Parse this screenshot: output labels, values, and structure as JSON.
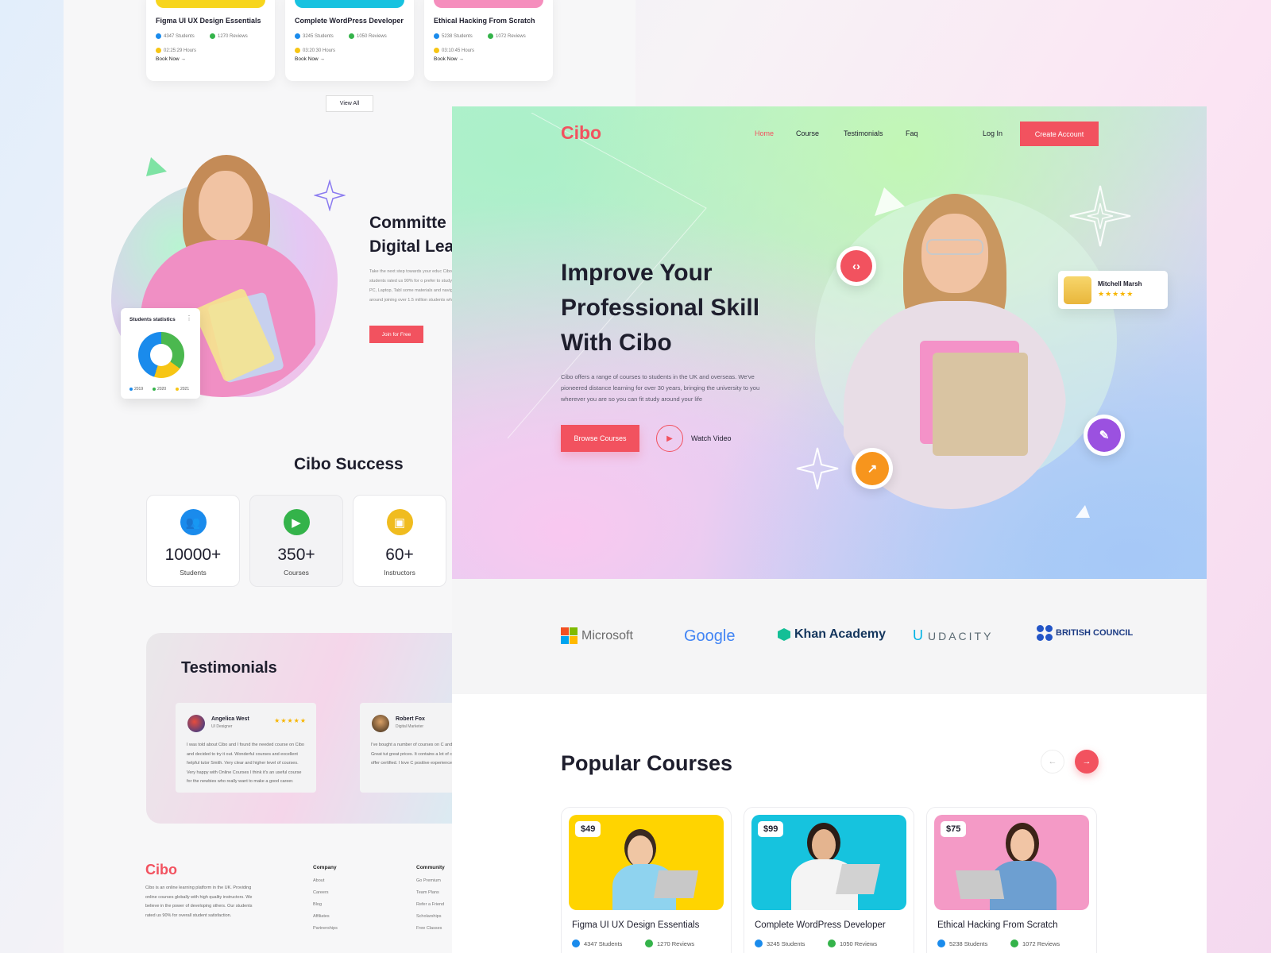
{
  "colors": {
    "accent": "#f2525f",
    "blue": "#1a8bec",
    "green": "#34b34a",
    "yellow": "#f7c514",
    "star": "#f7b500"
  },
  "back": {
    "mini_courses": [
      {
        "title": "Figma UI UX Design Essentials",
        "students": "4347 Students",
        "reviews": "1270 Reviews",
        "hours": "02:25:29 Hours",
        "cta": "Book Now →"
      },
      {
        "title": "Complete WordPress Developer",
        "students": "3245 Students",
        "reviews": "1050 Reviews",
        "hours": "03:20:30 Hours",
        "cta": "Book Now →"
      },
      {
        "title": "Ethical Hacking From Scratch",
        "students": "5238 Students",
        "reviews": "1072 Reviews",
        "hours": "03:10:45 Hours",
        "cta": "Book Now →"
      }
    ],
    "view_all": "View All",
    "stats_card": {
      "title": "Students statistics",
      "legend": [
        "2019",
        "2020",
        "2021"
      ]
    },
    "committed": {
      "line1": "Committe",
      "line2": "Digital Lea",
      "text": "Take the next step towards your educ Cibo. Our students rated us 90% for o prefer to study on a PC, Laptop, Tabl some materials and navigate around joining over 1.5 million students who",
      "cta": "Join for Free"
    },
    "success": {
      "title": "Cibo Success",
      "items": [
        {
          "value": "10000+",
          "label": "Students"
        },
        {
          "value": "350+",
          "label": "Courses"
        },
        {
          "value": "60+",
          "label": "Instructors"
        }
      ]
    },
    "testimonials": {
      "title": "Testimonials",
      "items": [
        {
          "name": "Angelica West",
          "role": "UI Designer",
          "stars": "★★★★★",
          "text": "I was told about Cibo and I found the needed course on Cibo and decided to try it out. Wonderful courses and excellent helpful tutor Smith. Very clear and higher level of courses. Very happy with Online Courses I think it's an useful course for the newbies who really want to make a good career."
        },
        {
          "name": "Robert Fox",
          "role": "Digital Marketer",
          "stars": "",
          "text": "I've bought a number of courses on C and they've been excellent. Great tut great prices. It contains a lot of cours Some of them offer certified. I love C positive experience buying. I highly r"
        }
      ]
    },
    "footer": {
      "logo": "Cibo",
      "text": "Cibo is an online learning platform in the UK. Providing online courses globally with high quality instructors. We believe in the power of developing others. Our students rated us 90% for overall student satisfaction.",
      "company": {
        "title": "Company",
        "links": [
          "About",
          "Careers",
          "Blog",
          "Affiliates",
          "Partnerships"
        ]
      },
      "community": {
        "title": "Community",
        "links": [
          "Go Premium",
          "Team Plans",
          "Refer a Friend",
          "Scholarships",
          "Free Classes"
        ]
      }
    }
  },
  "front": {
    "brand": "Cibo",
    "nav": [
      "Home",
      "Course",
      "Testimonials",
      "Faq"
    ],
    "login": "Log In",
    "create_account": "Create Account",
    "hero": {
      "title": "Improve Your Professional Skill With Cibo",
      "desc": "Cibo offers a range of courses to students in the UK and overseas. We've pioneered distance learning for over 30 years, bringing the university to you wherever you are so you can fit study around your life",
      "browse": "Browse Courses",
      "watch": "Watch Video"
    },
    "review_card": {
      "name": "Mitchell Marsh",
      "stars": "★★★★★"
    },
    "partners": [
      "Microsoft",
      "Google",
      "Khan Academy",
      "UDACITY",
      "BRITISH COUNCIL"
    ],
    "popular": {
      "title": "Popular Courses",
      "courses": [
        {
          "price": "$49",
          "title": "Figma UI UX Design Essentials",
          "students": "4347 Students",
          "reviews": "1270 Reviews"
        },
        {
          "price": "$99",
          "title": "Complete WordPress Developer",
          "students": "3245 Students",
          "reviews": "1050 Reviews"
        },
        {
          "price": "$75",
          "title": "Ethical Hacking From Scratch",
          "students": "5238 Students",
          "reviews": "1072 Reviews"
        }
      ]
    }
  }
}
